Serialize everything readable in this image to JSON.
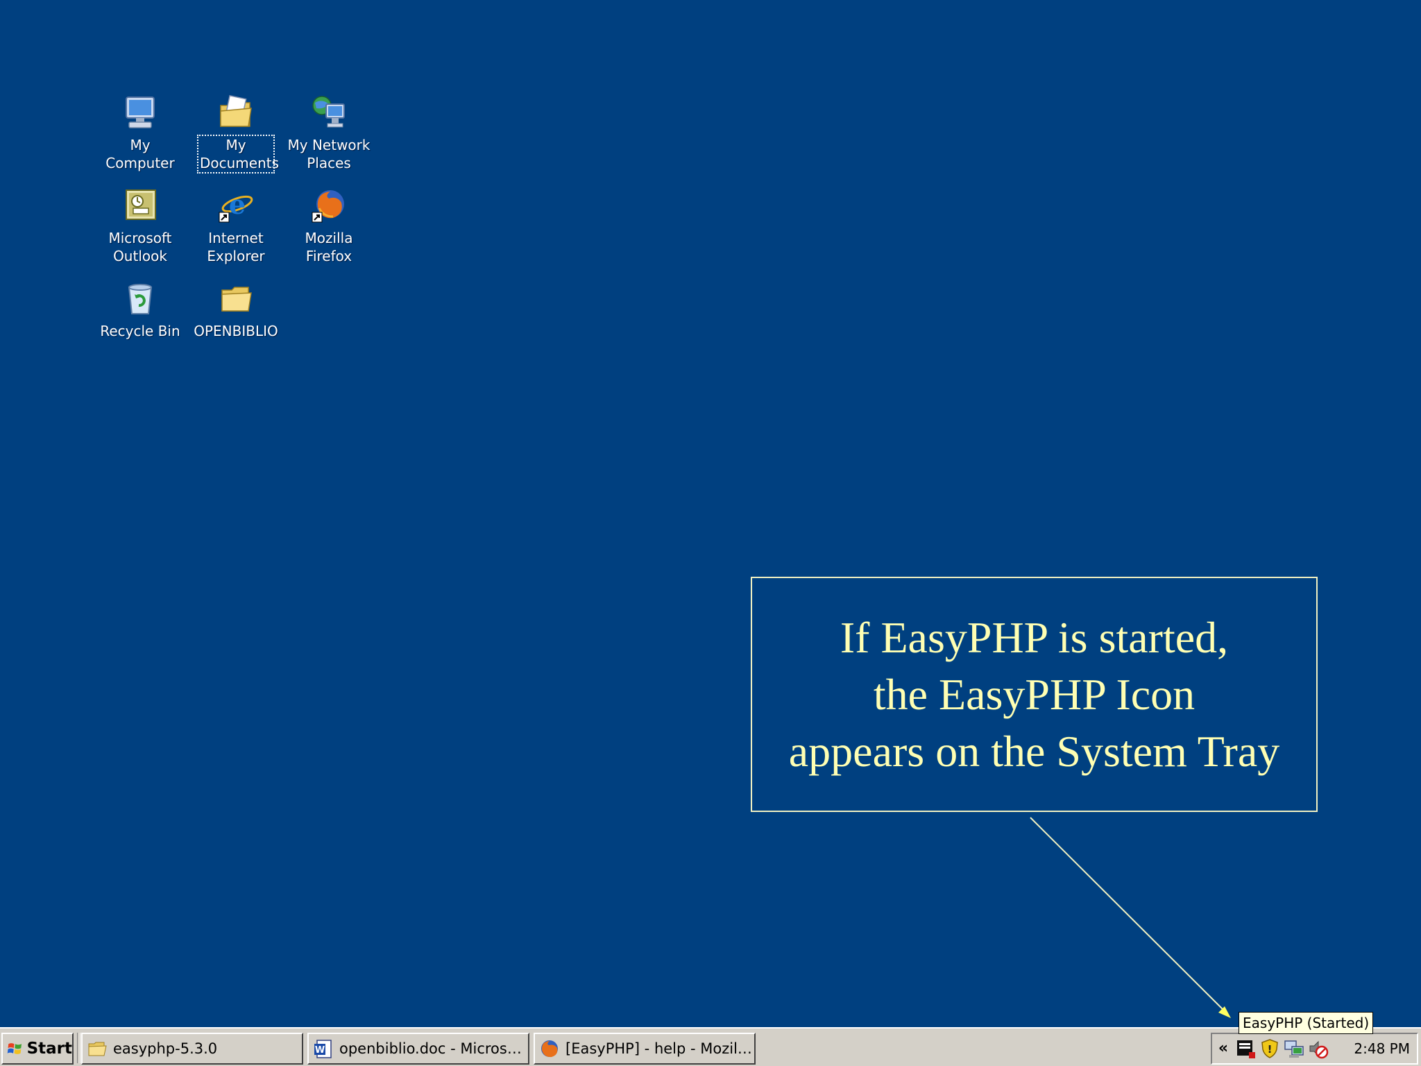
{
  "desktop": {
    "background_color": "#004080",
    "icons": [
      {
        "label": "My Computer",
        "icon": "my-computer-icon"
      },
      {
        "label": "My Documents",
        "icon": "my-documents-icon",
        "selected": true
      },
      {
        "label": "My Network Places",
        "icon": "my-network-places-icon"
      },
      {
        "label": "Microsoft Outlook",
        "icon": "microsoft-outlook-icon"
      },
      {
        "label": "Internet Explorer",
        "icon": "internet-explorer-icon"
      },
      {
        "label": "Mozilla Firefox",
        "icon": "mozilla-firefox-icon"
      },
      {
        "label": "Recycle Bin",
        "icon": "recycle-bin-icon"
      },
      {
        "label": "OPENBIBLIO",
        "icon": "folder-icon"
      }
    ]
  },
  "callout": {
    "lines": [
      "If EasyPHP is started,",
      "the EasyPHP Icon",
      "appears on the System Tray"
    ],
    "text_color": "#ffffb3",
    "border_color": "#f2f2c2"
  },
  "tooltip": {
    "text": "EasyPHP (Started)"
  },
  "taskbar": {
    "start_label": "Start",
    "tasks": [
      {
        "label": "easyphp-5.3.0",
        "icon": "folder-icon"
      },
      {
        "label": "openbiblio.doc - Microsof...",
        "icon": "word-document-icon"
      },
      {
        "label": "[EasyPHP] - help - Mozill...",
        "icon": "firefox-icon"
      }
    ],
    "tray": {
      "expand_label": "«",
      "icons": [
        "easyphp-tray-icon",
        "security-shield-icon",
        "network-icon",
        "sound-muted-icon"
      ],
      "clock": "2:48 PM"
    }
  }
}
